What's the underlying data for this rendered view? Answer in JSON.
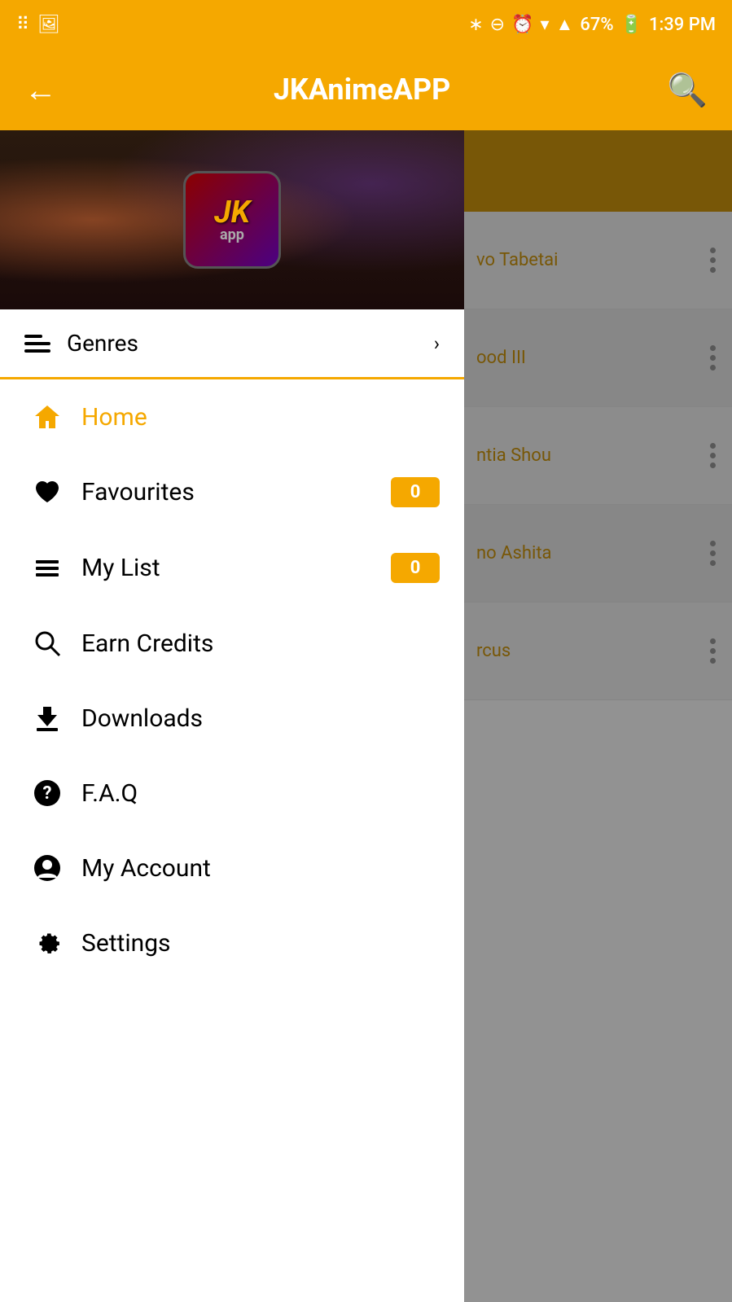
{
  "statusBar": {
    "time": "1:39 PM",
    "battery": "67%",
    "icons": [
      "bluetooth",
      "dnd",
      "alarm",
      "wifi",
      "signal",
      "battery"
    ]
  },
  "appBar": {
    "title": "JKAnimeAPP",
    "backLabel": "←",
    "searchLabel": "🔍"
  },
  "drawer": {
    "logo": {
      "jk": "JK",
      "app": "app"
    },
    "genres": {
      "label": "Genres",
      "arrow": "›"
    },
    "menuItems": [
      {
        "id": "home",
        "label": "Home",
        "icon": "house",
        "badge": null,
        "active": true
      },
      {
        "id": "favourites",
        "label": "Favourites",
        "icon": "heart",
        "badge": "0",
        "active": false
      },
      {
        "id": "my-list",
        "label": "My List",
        "icon": "list",
        "badge": "0",
        "active": false
      },
      {
        "id": "earn-credits",
        "label": "Earn Credits",
        "icon": "search",
        "badge": null,
        "active": false
      },
      {
        "id": "downloads",
        "label": "Downloads",
        "icon": "download",
        "badge": null,
        "active": false
      },
      {
        "id": "faq",
        "label": "F.A.Q",
        "icon": "question",
        "badge": null,
        "active": false
      },
      {
        "id": "my-account",
        "label": "My Account",
        "icon": "account",
        "badge": null,
        "active": false
      },
      {
        "id": "settings",
        "label": "Settings",
        "icon": "gear",
        "badge": null,
        "active": false
      }
    ]
  },
  "rightContent": {
    "items": [
      {
        "text": "vo Tabetai",
        "hasDots": true
      },
      {
        "text": "ood III",
        "hasDots": true
      },
      {
        "text": "ntia Shou",
        "hasDots": true
      },
      {
        "text": "no Ashita",
        "hasDots": true
      },
      {
        "text": "rcus",
        "hasDots": true
      }
    ]
  }
}
